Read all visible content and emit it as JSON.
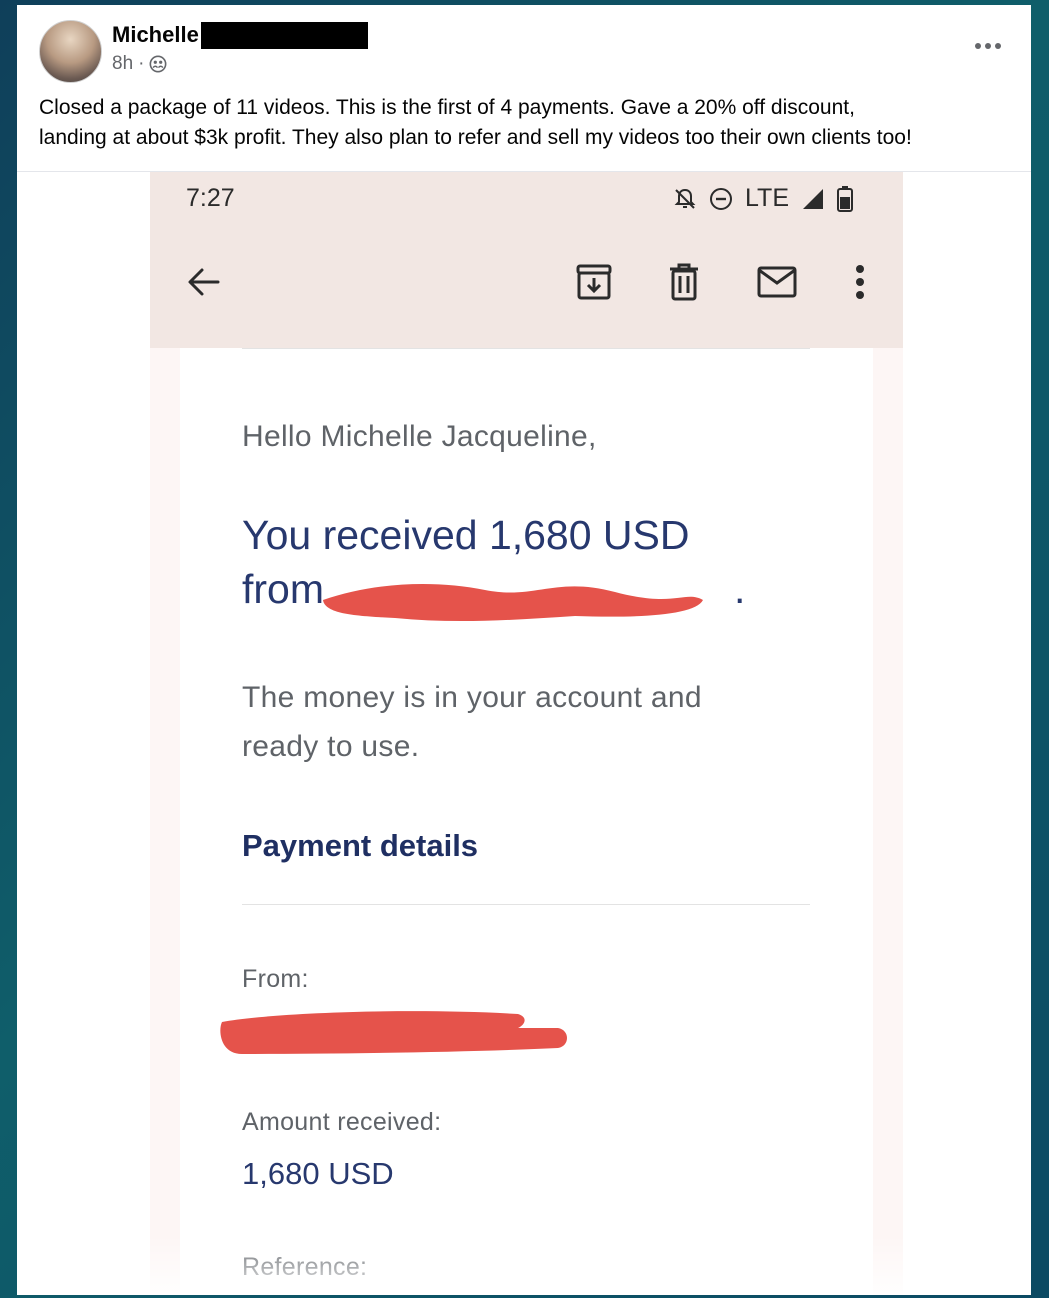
{
  "post": {
    "author_name": "Michelle",
    "time": "8h",
    "separator": "·",
    "text_line1": "Closed a package of 11 videos. This is the first of 4 payments. Gave a 20% off discount,",
    "text_line2": "landing at about $3k profit. They also plan to refer and sell my videos too their own clients too!",
    "audience_icon": "friends-icon",
    "more_icon": "more-horizontal-icon"
  },
  "phone": {
    "status": {
      "time": "7:27",
      "network": "LTE"
    },
    "app_bar": {
      "back_icon": "arrow-left-icon",
      "actions": [
        "archive-icon",
        "delete-icon",
        "mark-unread-icon",
        "more-vertical-icon"
      ]
    },
    "email": {
      "greeting": "Hello Michelle Jacqueline,",
      "headline_line1": "You received 1,680 USD",
      "headline_line2_prefix": "from",
      "headline_line2_suffix": ".",
      "body_line1": "The money is in your account and",
      "body_line2": "ready to use.",
      "section_title": "Payment details",
      "from_label": "From:",
      "amount_label": "Amount received:",
      "amount_value": "1,680 USD",
      "reference_label": "Reference:"
    }
  },
  "colors": {
    "background": "#0f5e6a",
    "status_bar": "#f2e7e3",
    "headline": "#27386e",
    "redaction": "#e5534b"
  }
}
